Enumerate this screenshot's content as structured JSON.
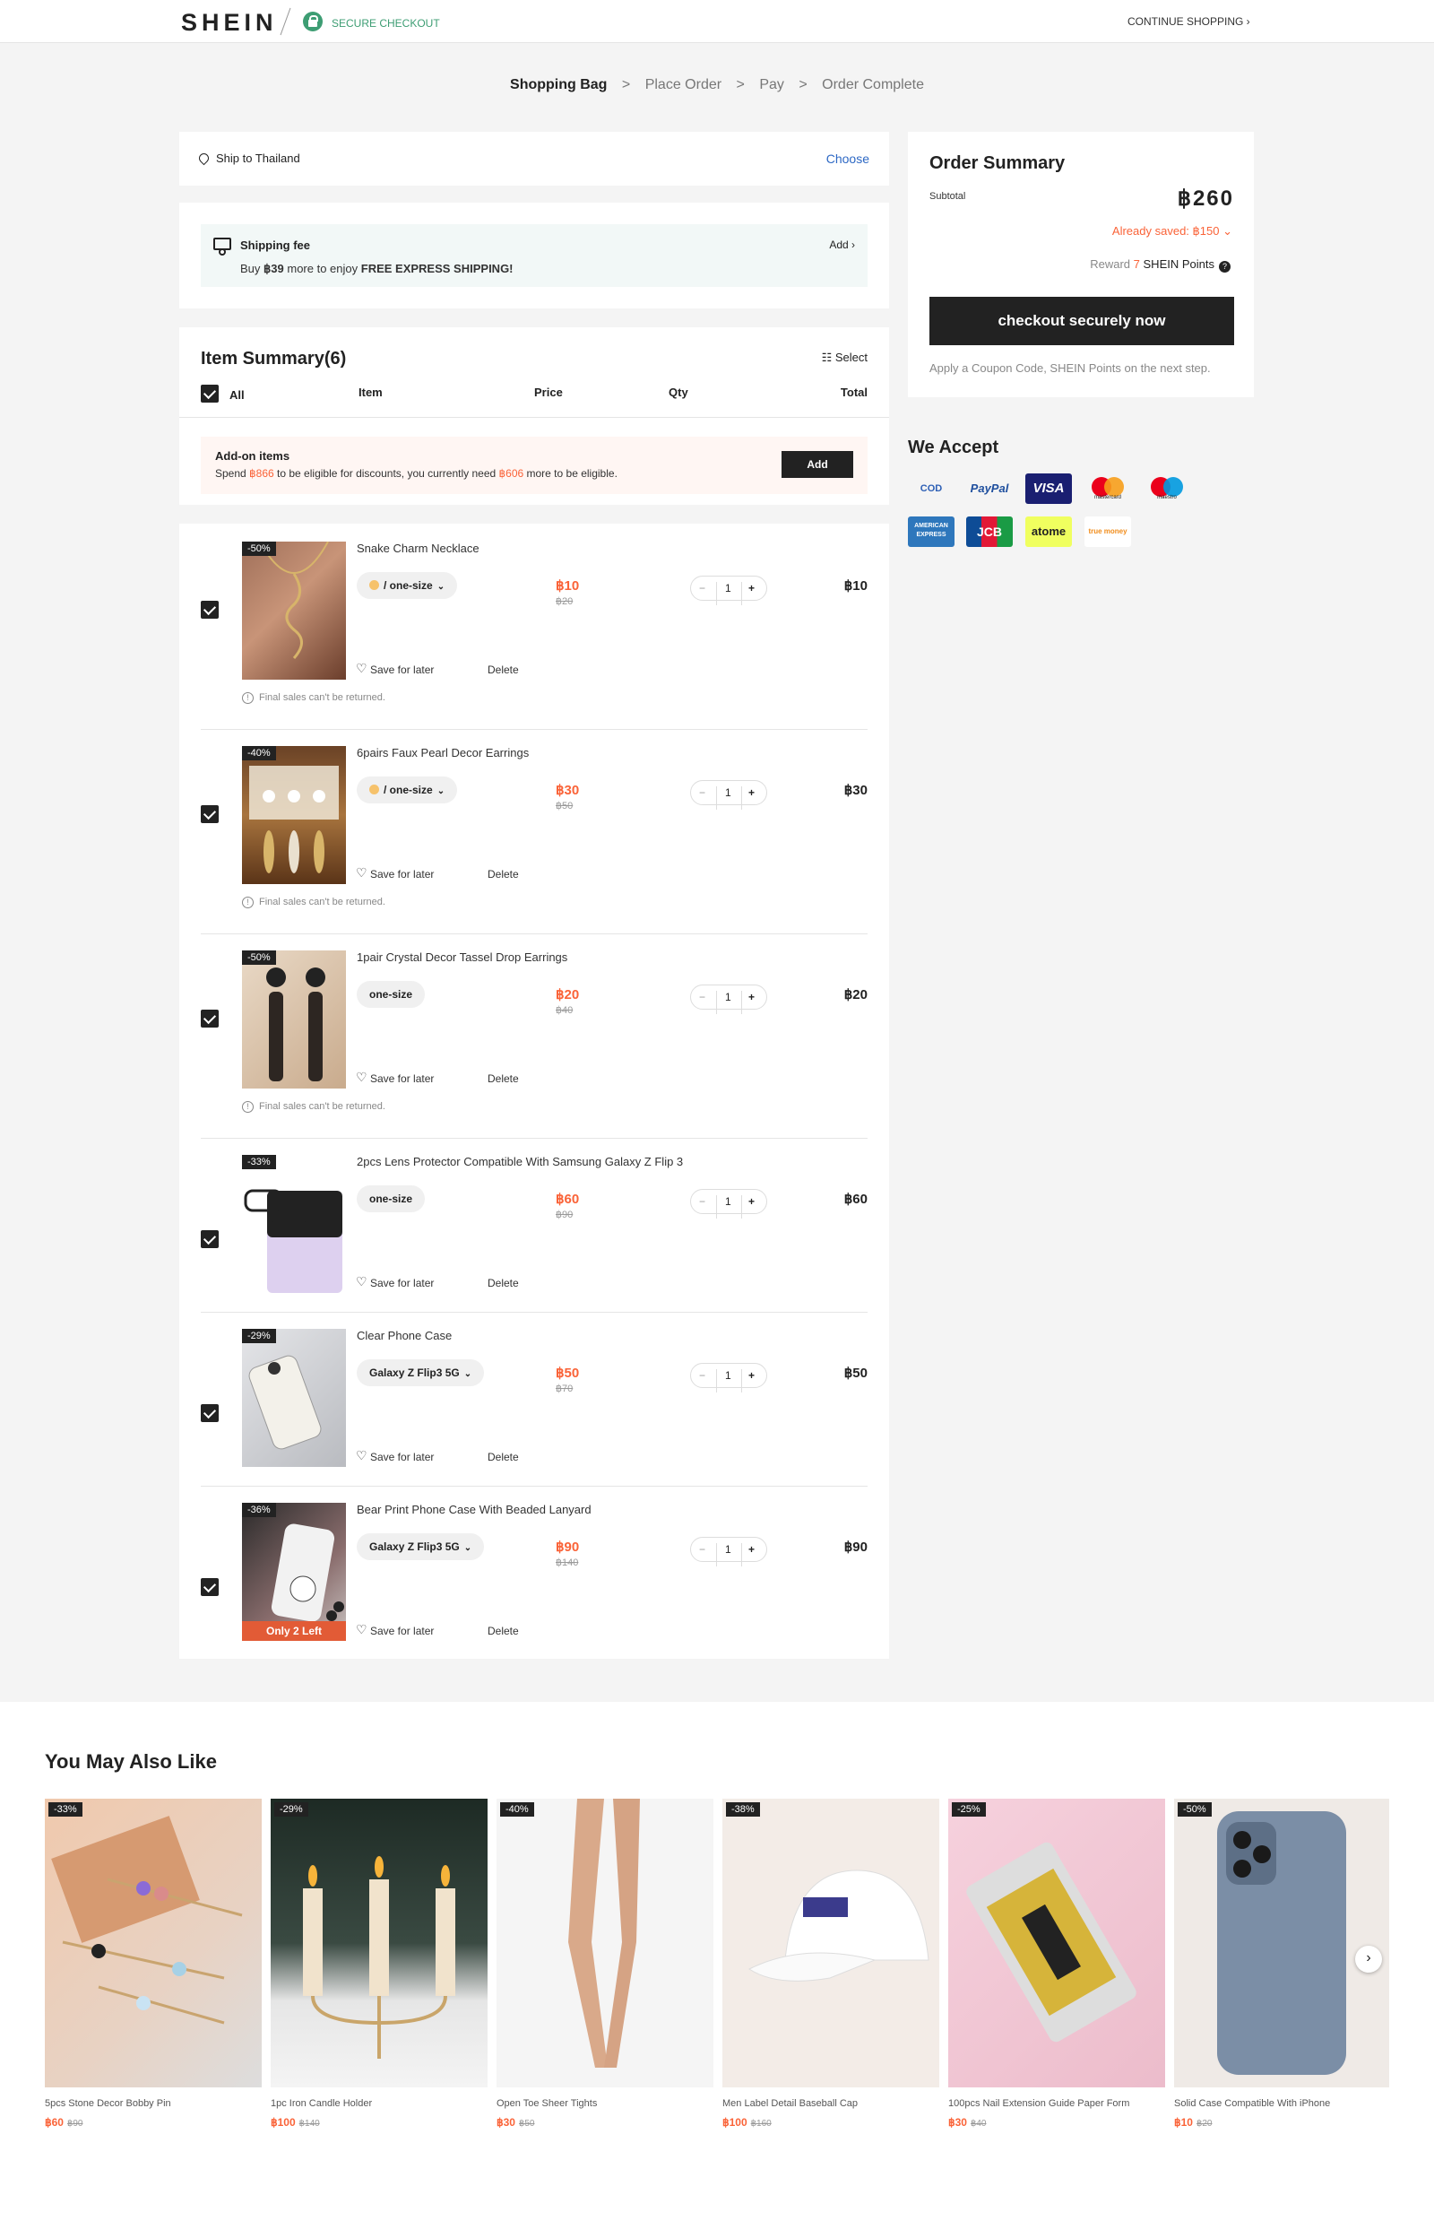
{
  "header": {
    "logo": "SHEIN",
    "secure": "SECURE CHECKOUT",
    "continue": "CONTINUE SHOPPING ›"
  },
  "steps": [
    "Shopping Bag",
    "Place Order",
    "Pay",
    "Order Complete"
  ],
  "step_sep": ">",
  "ship": {
    "label": "Ship to Thailand",
    "action": "Choose"
  },
  "shipping_fee": {
    "title": "Shipping fee",
    "desc_prefix": "Buy ",
    "desc_amount": "฿39",
    "desc_suffix": " more to enjoy ",
    "desc_bold": "FREE EXPRESS SHIPPING!",
    "add": "Add ›"
  },
  "summary": {
    "title": "Item Summary(6)",
    "select": "☷ Select",
    "headers": {
      "all": "All",
      "item": "Item",
      "price": "Price",
      "qty": "Qty",
      "total": "Total"
    }
  },
  "addon": {
    "title": "Add-on items",
    "d1": "Spend ",
    "a1": "฿866",
    "d2": " to be eligible for discounts, you currently need ",
    "a2": "฿606",
    "d3": " more to be eligible.",
    "button": "Add"
  },
  "items": [
    {
      "name": "Snake Charm Necklace",
      "discount": "-50%",
      "variant": "/ one-size",
      "dot": true,
      "price": "฿10",
      "orig": "฿20",
      "qty": "1",
      "total": "฿10",
      "final": "Final sales can't be returned.",
      "only": ""
    },
    {
      "name": "6pairs Faux Pearl Decor Earrings",
      "discount": "-40%",
      "variant": "/ one-size",
      "dot": true,
      "price": "฿30",
      "orig": "฿50",
      "qty": "1",
      "total": "฿30",
      "final": "Final sales can't be returned.",
      "only": ""
    },
    {
      "name": "1pair Crystal Decor Tassel Drop Earrings",
      "discount": "-50%",
      "variant": "one-size",
      "dot": false,
      "price": "฿20",
      "orig": "฿40",
      "qty": "1",
      "total": "฿20",
      "final": "Final sales can't be returned.",
      "only": ""
    },
    {
      "name": "2pcs Lens Protector Compatible With Samsung Galaxy Z Flip 3",
      "discount": "-33%",
      "variant": "one-size",
      "dot": false,
      "price": "฿60",
      "orig": "฿90",
      "qty": "1",
      "total": "฿60",
      "final": "",
      "only": ""
    },
    {
      "name": "Clear Phone Case",
      "discount": "-29%",
      "variant": "Galaxy Z Flip3 5G",
      "dot": false,
      "price": "฿50",
      "orig": "฿70",
      "qty": "1",
      "total": "฿50",
      "final": "",
      "only": ""
    },
    {
      "name": "Bear Print Phone Case With Beaded Lanyard",
      "discount": "-36%",
      "variant": "Galaxy Z Flip3 5G",
      "dot": false,
      "price": "฿90",
      "orig": "฿140",
      "qty": "1",
      "total": "฿90",
      "final": "",
      "only": "Only 2 Left"
    }
  ],
  "item_actions": {
    "save": "Save for later",
    "delete": "Delete",
    "minus": "−",
    "plus": "+"
  },
  "order_summary": {
    "title": "Order Summary",
    "subtotal_label": "Subtotal",
    "subtotal": "฿260",
    "saved": "Already saved: ฿150 ⌄",
    "reward_prefix": "Reward ",
    "reward_n": "7",
    "reward_suffix": "SHEIN Points",
    "qm": "?",
    "checkout": "checkout securely now",
    "note": "Apply a Coupon Code, SHEIN Points on the next step."
  },
  "we_accept": {
    "title": "We Accept",
    "methods": [
      "COD",
      "PayPal",
      "VISA",
      "mastercard",
      "maestro",
      "AMERICAN EXPRESS",
      "JCB",
      "atome",
      "true money"
    ]
  },
  "recommend": {
    "title": "You May Also Like",
    "products": [
      {
        "name": "5pcs Stone Decor Bobby Pin",
        "discount": "-33%",
        "price": "฿60",
        "orig": "฿90"
      },
      {
        "name": "1pc Iron Candle Holder",
        "discount": "-29%",
        "price": "฿100",
        "orig": "฿140"
      },
      {
        "name": "Open Toe Sheer Tights",
        "discount": "-40%",
        "price": "฿30",
        "orig": "฿50"
      },
      {
        "name": "Men Label Detail Baseball Cap",
        "discount": "-38%",
        "price": "฿100",
        "orig": "฿160"
      },
      {
        "name": "100pcs Nail Extension Guide Paper Form",
        "discount": "-25%",
        "price": "฿30",
        "orig": "฿40"
      },
      {
        "name": "Solid Case Compatible With iPhone",
        "discount": "-50%",
        "price": "฿10",
        "orig": "฿20"
      }
    ],
    "next": "›"
  }
}
